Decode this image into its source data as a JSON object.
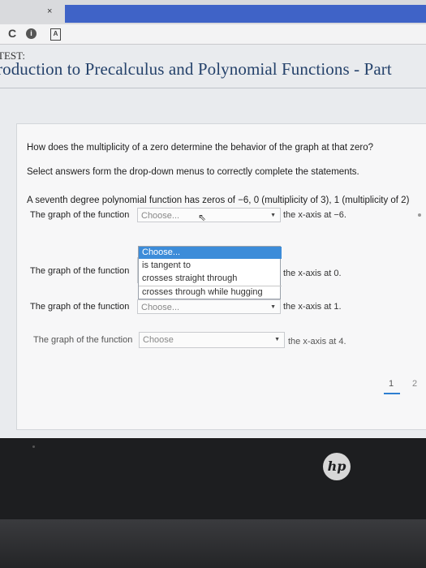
{
  "browser": {
    "tab_close": "×",
    "reload_icon": "reload-icon",
    "info_icon": "info-icon",
    "reader_icon": "reader-icon",
    "icons": {
      "reload": "C",
      "info": "i",
      "reader": "A"
    }
  },
  "header": {
    "test_label": "TEST:",
    "title": "roduction to Precalculus and Polynomial Functions - Part"
  },
  "question": {
    "prompt": "How does the multiplicity of a zero determine the behavior of the graph at that zero?",
    "instructions": "Select answers form the drop-down menus to correctly complete the statements.",
    "statement": "A seventh degree polynomial function has zeros of −6, 0 (multiplicity of 3), 1 (multiplicity of 2)"
  },
  "rows": [
    {
      "label": "The graph of the function",
      "select_value": "Choose...",
      "after": "the x-axis at −6."
    },
    {
      "label": "The graph of the function",
      "select_value": "",
      "after": "the x-axis at 0."
    },
    {
      "label": "The graph of the function",
      "select_value": "Choose...",
      "after": "the x-axis at 1."
    },
    {
      "label": "The graph of the function",
      "select_value": "Choose",
      "after": "the x-axis at 4."
    }
  ],
  "dropdown": {
    "options": [
      "Choose...",
      "is tangent to",
      "crosses straight through",
      "crosses through while hugging"
    ],
    "selected_index": 0
  },
  "pager": {
    "pages": [
      "1",
      "2"
    ],
    "current": "1"
  },
  "device": {
    "logo": "hp"
  },
  "colors": {
    "accent": "#3c8cd9",
    "title": "#25426b",
    "browser_strip": "#3f63c7"
  }
}
